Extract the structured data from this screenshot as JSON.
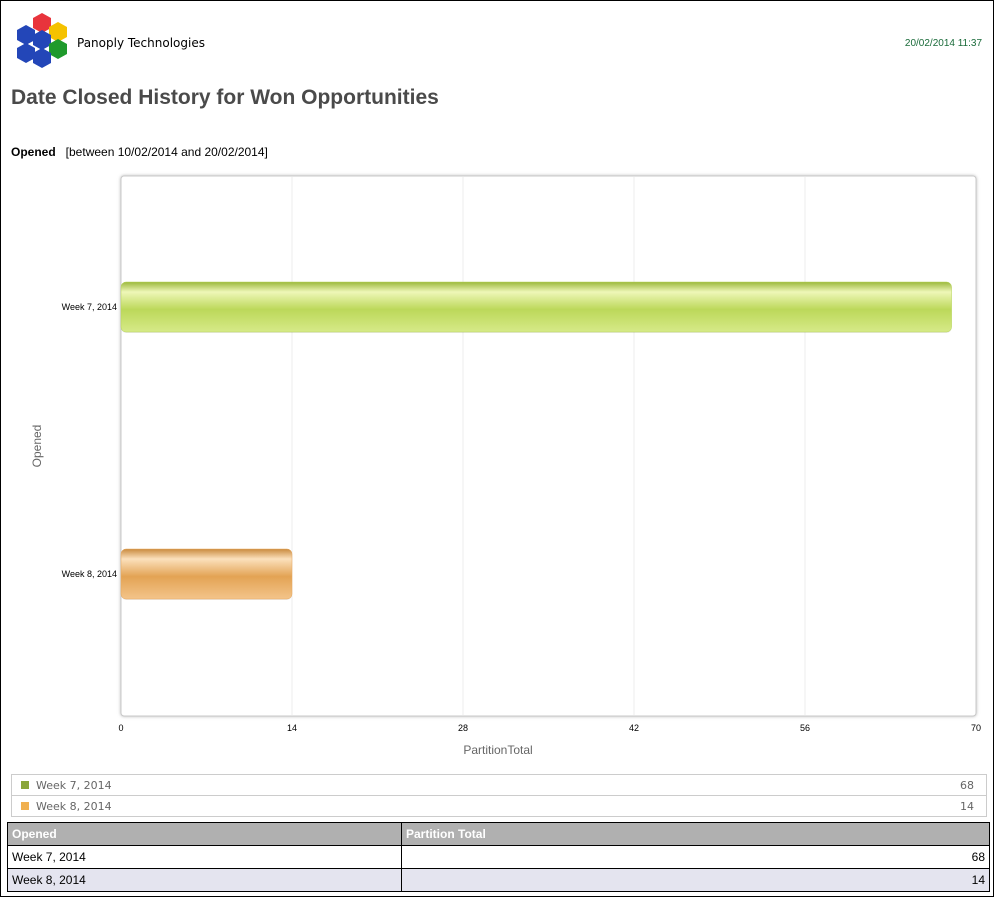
{
  "header": {
    "company": "Panoply Technologies",
    "timestamp": "20/02/2014 11:37",
    "title": "Date Closed History for Won Opportunities"
  },
  "filter": {
    "label": "Opened",
    "value": "[between 10/02/2014 and 20/02/2014]"
  },
  "logo": {
    "colors": [
      "#e8343c",
      "#f5c200",
      "#2346b8",
      "#1f9a2c"
    ]
  },
  "chart_data": {
    "type": "bar",
    "orientation": "horizontal",
    "categories": [
      "Week 7, 2014",
      "Week 8, 2014"
    ],
    "values": [
      68,
      14
    ],
    "colors": [
      "#b7d45a",
      "#e8a85c"
    ],
    "xlabel": "PartitionTotal",
    "ylabel": "Opened",
    "xlim": [
      0,
      70
    ],
    "xticks": [
      "0",
      "14",
      "28",
      "42",
      "56",
      "70"
    ],
    "grid": true
  },
  "legend": {
    "items": [
      {
        "name": "Week 7, 2014",
        "value": "68",
        "color": "#8aa63a"
      },
      {
        "name": "Week 8, 2014",
        "value": "14",
        "color": "#f0b050"
      }
    ]
  },
  "table": {
    "headers": [
      "Opened",
      "Partition Total"
    ],
    "rows": [
      [
        "Week 7, 2014",
        "68"
      ],
      [
        "Week 8, 2014",
        "14"
      ]
    ]
  }
}
